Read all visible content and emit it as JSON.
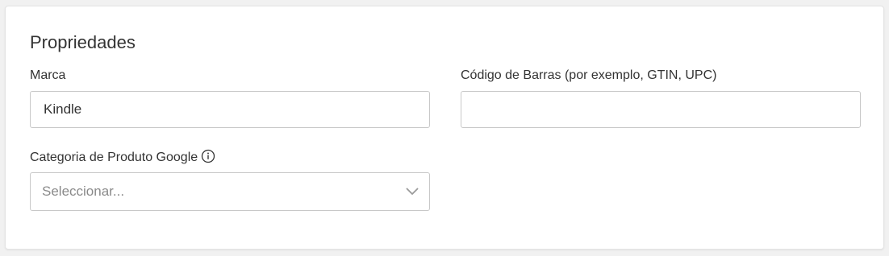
{
  "section": {
    "title": "Propriedades"
  },
  "fields": {
    "brand": {
      "label": "Marca",
      "value": "Kindle",
      "placeholder": ""
    },
    "barcode": {
      "label": "Código de Barras (por exemplo, GTIN, UPC)",
      "value": "",
      "placeholder": ""
    },
    "google_category": {
      "label": "Categoria de Produto Google",
      "selected": "Seleccionar...",
      "info_icon": "info-icon",
      "dropdown_icon": "chevron-down-icon"
    }
  },
  "colors": {
    "text": "#333333",
    "border": "#c8c8c8",
    "placeholder": "#8a8a8a",
    "background": "#f1f1f1",
    "card": "#ffffff"
  }
}
